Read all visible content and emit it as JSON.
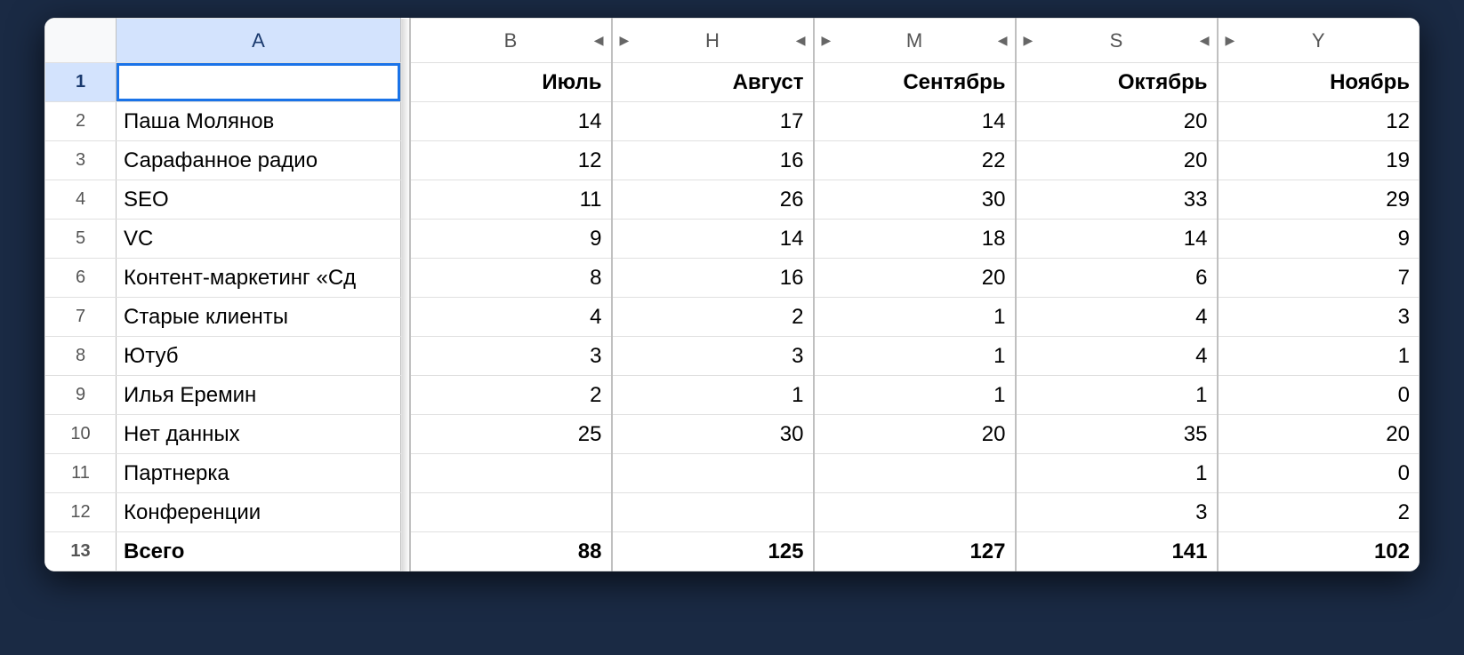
{
  "columns": {
    "row_label": "A",
    "groups": [
      {
        "letter": "B",
        "arrow_left": false,
        "arrow_right": true
      },
      {
        "letter": "H",
        "arrow_left": true,
        "arrow_right": true
      },
      {
        "letter": "M",
        "arrow_left": true,
        "arrow_right": true
      },
      {
        "letter": "S",
        "arrow_left": true,
        "arrow_right": true
      },
      {
        "letter": "Y",
        "arrow_left": true,
        "arrow_right": false
      }
    ]
  },
  "header_row": {
    "rownum": "1",
    "a": "",
    "values": [
      "Июль",
      "Август",
      "Сентябрь",
      "Октябрь",
      "Ноябрь"
    ]
  },
  "rows": [
    {
      "rownum": "2",
      "a": "Паша Молянов",
      "values": [
        "14",
        "17",
        "14",
        "20",
        "12"
      ]
    },
    {
      "rownum": "3",
      "a": "Сарафанное радио",
      "values": [
        "12",
        "16",
        "22",
        "20",
        "19"
      ]
    },
    {
      "rownum": "4",
      "a": "SEO",
      "values": [
        "11",
        "26",
        "30",
        "33",
        "29"
      ]
    },
    {
      "rownum": "5",
      "a": "VC",
      "values": [
        "9",
        "14",
        "18",
        "14",
        "9"
      ]
    },
    {
      "rownum": "6",
      "a": "Контент-маркетинг «Сд",
      "values": [
        "8",
        "16",
        "20",
        "6",
        "7"
      ]
    },
    {
      "rownum": "7",
      "a": "Старые клиенты",
      "values": [
        "4",
        "2",
        "1",
        "4",
        "3"
      ]
    },
    {
      "rownum": "8",
      "a": "Ютуб",
      "values": [
        "3",
        "3",
        "1",
        "4",
        "1"
      ]
    },
    {
      "rownum": "9",
      "a": "Илья Еремин",
      "values": [
        "2",
        "1",
        "1",
        "1",
        "0"
      ]
    },
    {
      "rownum": "10",
      "a": "Нет данных",
      "values": [
        "25",
        "30",
        "20",
        "35",
        "20"
      ]
    },
    {
      "rownum": "11",
      "a": "Партнерка",
      "values": [
        "",
        "",
        "",
        "1",
        "0"
      ]
    },
    {
      "rownum": "12",
      "a": "Конференции",
      "values": [
        "",
        "",
        "",
        "3",
        "2"
      ]
    }
  ],
  "total_row": {
    "rownum": "13",
    "a": "Всего",
    "values": [
      "88",
      "125",
      "127",
      "141",
      "102"
    ]
  },
  "glyphs": {
    "tri_left": "◀",
    "tri_right": "▶"
  }
}
